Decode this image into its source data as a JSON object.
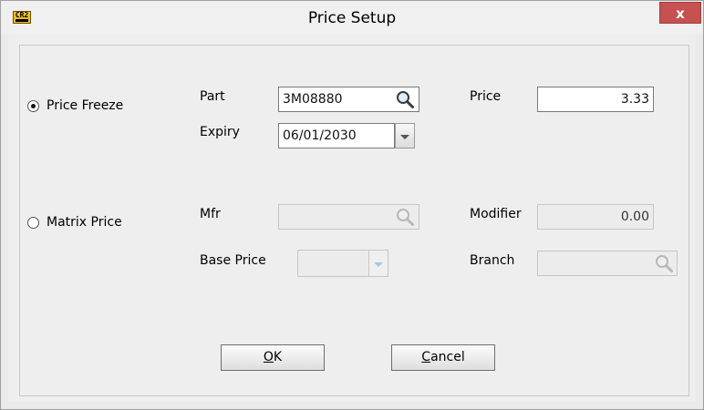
{
  "window": {
    "title": "Price Setup",
    "app_icon_text": "CR2",
    "close_label": "x"
  },
  "price_freeze": {
    "radio_label": "Price Freeze",
    "selected": true,
    "part_label": "Part",
    "part_value": "3M08880",
    "expiry_label": "Expiry",
    "expiry_value": "06/01/2030",
    "price_label": "Price",
    "price_value": "3.33"
  },
  "matrix_price": {
    "radio_label": "Matrix Price",
    "selected": false,
    "mfr_label": "Mfr",
    "mfr_value": "",
    "base_price_label": "Base Price",
    "base_price_value": "",
    "modifier_label": "Modifier",
    "modifier_value": "0.00",
    "branch_label": "Branch",
    "branch_value": ""
  },
  "buttons": {
    "ok_mnemonic": "O",
    "ok_rest": "K",
    "cancel_mnemonic": "C",
    "cancel_rest": "ancel"
  },
  "icons": {
    "search": "magnifier-icon",
    "dropdown": "chevron-down-icon"
  }
}
